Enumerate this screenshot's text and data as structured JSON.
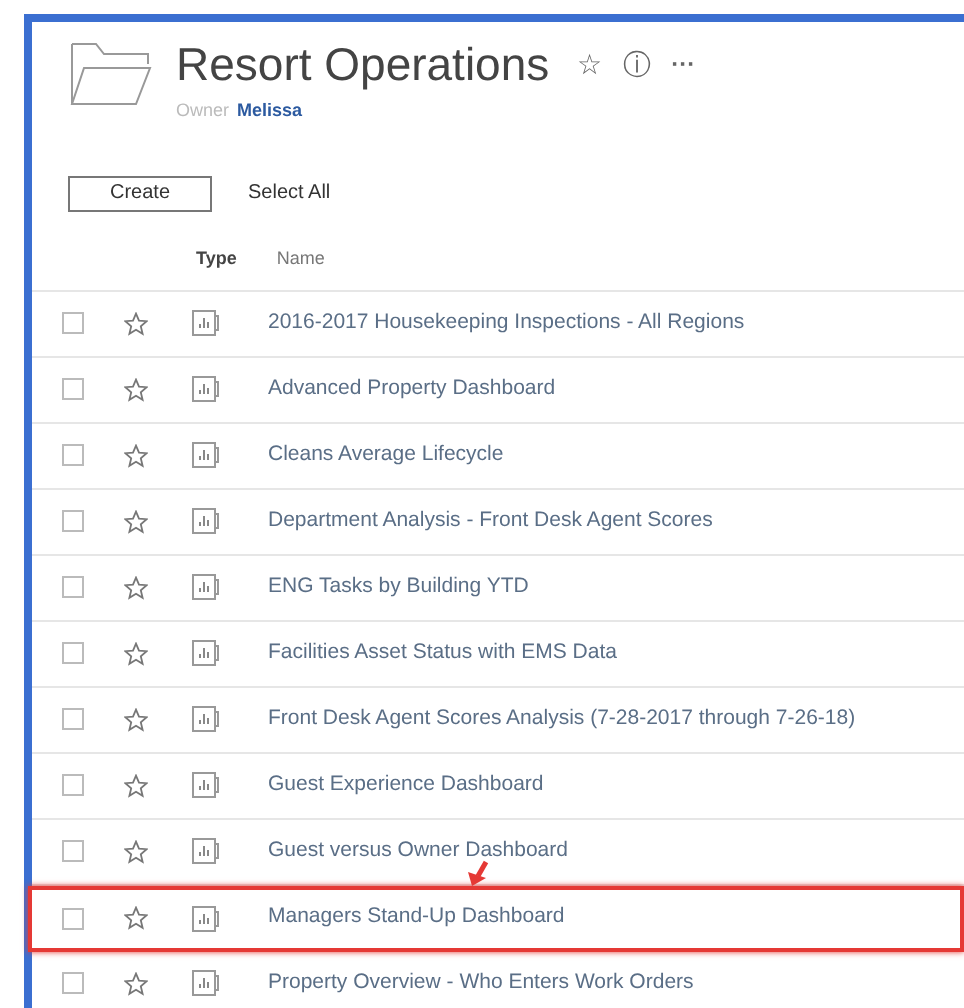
{
  "header": {
    "title": "Resort Operations",
    "owner_label": "Owner",
    "owner": "Melissa",
    "actions": [
      "☆",
      "ⓘ",
      "···"
    ]
  },
  "toolbar": {
    "create": "Create",
    "select_all": "Select All"
  },
  "table": {
    "columns": [
      "Type",
      "Name"
    ],
    "rows": [
      {
        "name": "2016-2017 Housekeeping Inspections - All Regions",
        "checked": false,
        "highlighted": false
      },
      {
        "name": "Advanced Property Dashboard",
        "checked": false,
        "highlighted": false
      },
      {
        "name": "Cleans Average Lifecycle",
        "checked": false,
        "highlighted": false
      },
      {
        "name": "Department Analysis - Front Desk Agent Scores",
        "checked": false,
        "highlighted": false
      },
      {
        "name": "ENG Tasks by Building YTD",
        "checked": false,
        "highlighted": false
      },
      {
        "name": "Facilities Asset Status with EMS Data",
        "checked": false,
        "highlighted": false
      },
      {
        "name": "Front Desk Agent Scores Analysis (7-28-2017 through 7-26-18)",
        "checked": false,
        "highlighted": false
      },
      {
        "name": "Guest Experience Dashboard",
        "checked": false,
        "highlighted": false
      },
      {
        "name": "Guest versus Owner Dashboard",
        "checked": false,
        "highlighted": false
      },
      {
        "name": "Managers Stand-Up Dashboard",
        "checked": false,
        "highlighted": true
      },
      {
        "name": "Property Overview - Who Enters Work Orders",
        "checked": false,
        "highlighted": false
      }
    ]
  }
}
